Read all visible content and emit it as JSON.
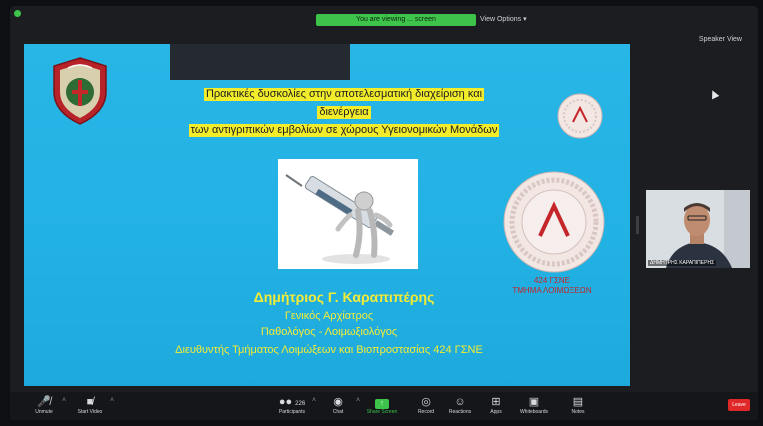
{
  "zoom": {
    "share_banner": "You are viewing ... screen",
    "view_options": "View Options",
    "top_right_label": "Speaker View"
  },
  "slide": {
    "title_lines": [
      "Πρακτικές δυσκολίες στην αποτελεσματική διαχείριση και",
      "διενέργεια",
      "των αντιγριπικών εμβολίων σε χώρους Υγειονομικών Μονάδων"
    ],
    "speaker_name": "Δημήτριος Γ. Καραπιπέρης",
    "speaker_roles": [
      "Γενικός Αρχίατρος",
      "Παθολόγος - Λοιμωξιολόγος",
      "Διευθυντής Τμήματος Λοιμώξεων και Βιοπροστασίας 424 ΓΣΝΕ"
    ],
    "dept_label_lines": [
      "424 ΓΣΝΕ",
      "ΤΜΗΜΑ ΛΟΙΜΩΞΕΩΝ"
    ]
  },
  "participant": {
    "name": "ΔΗΜΗΤΡΗΣ ΚΑΡΑΠΙΠΕΡΗΣ"
  },
  "toolbar": {
    "unmute": "Unmute",
    "start_video": "Start Video",
    "participants": "Participants",
    "participants_count": "226",
    "chat": "Chat",
    "share_screen": "Share Screen",
    "record": "Record",
    "reactions": "Reactions",
    "apps": "Apps",
    "whiteboards": "Whiteboards",
    "notes": "Notes",
    "leave": "Leave"
  },
  "colors": {
    "slide_bg": "#22b1e3",
    "highlight_yellow": "#f2ec2a",
    "speaker_text": "#f4ec34",
    "dept_red": "#c4262a",
    "share_green": "#3ec44a",
    "leave_red": "#e02828"
  },
  "icons": {
    "unmute": "microphone-muted-icon",
    "start_video": "video-camera-off-icon",
    "participants": "people-icon",
    "chat": "chat-bubble-icon",
    "share_screen": "share-screen-icon",
    "record": "record-icon",
    "reactions": "smiley-icon",
    "apps": "apps-icon",
    "whiteboards": "whiteboard-icon",
    "notes": "notes-icon"
  }
}
